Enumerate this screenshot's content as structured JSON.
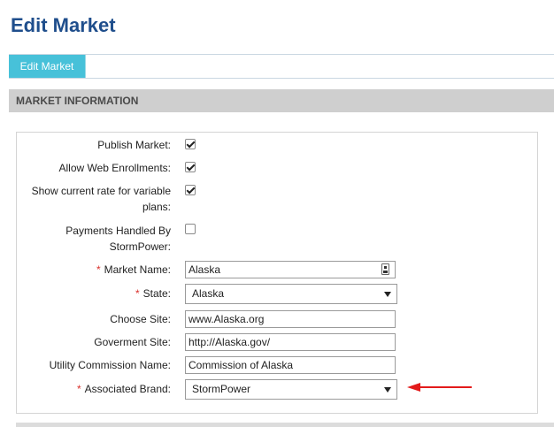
{
  "page": {
    "title": "Edit Market"
  },
  "tabs": [
    {
      "label": "Edit Market",
      "active": true
    }
  ],
  "section": {
    "title": "MARKET INFORMATION"
  },
  "form": {
    "publish_market": {
      "label": "Publish Market:",
      "checked": true
    },
    "allow_web_enrollments": {
      "label": "Allow Web Enrollments:",
      "checked": true
    },
    "show_current_rate": {
      "label_line1": "Show current rate for variable",
      "label_line2": "plans:",
      "checked": true
    },
    "payments_handled": {
      "label_line1": "Payments Handled By",
      "label_line2": "StormPower:",
      "checked": false
    },
    "market_name": {
      "label": "Market Name:",
      "value": "Alaska",
      "required": true
    },
    "state": {
      "label": "State:",
      "value": "Alaska",
      "required": true
    },
    "choose_site": {
      "label": "Choose Site:",
      "value": "www.Alaska.org"
    },
    "government_site": {
      "label": "Goverment Site:",
      "value": "http://Alaska.gov/"
    },
    "utility_commission_name": {
      "label": "Utility Commission Name:",
      "value": "Commission of Alaska"
    },
    "associated_brand": {
      "label": "Associated Brand:",
      "value": "StormPower",
      "required": true
    }
  },
  "required_marker": "*",
  "colors": {
    "title": "#1f4e8c",
    "tab_active_bg": "#47c1d9",
    "section_header_bg": "#cfcfcf",
    "required": "#d9302b",
    "annotation_arrow": "#e31b1b"
  }
}
